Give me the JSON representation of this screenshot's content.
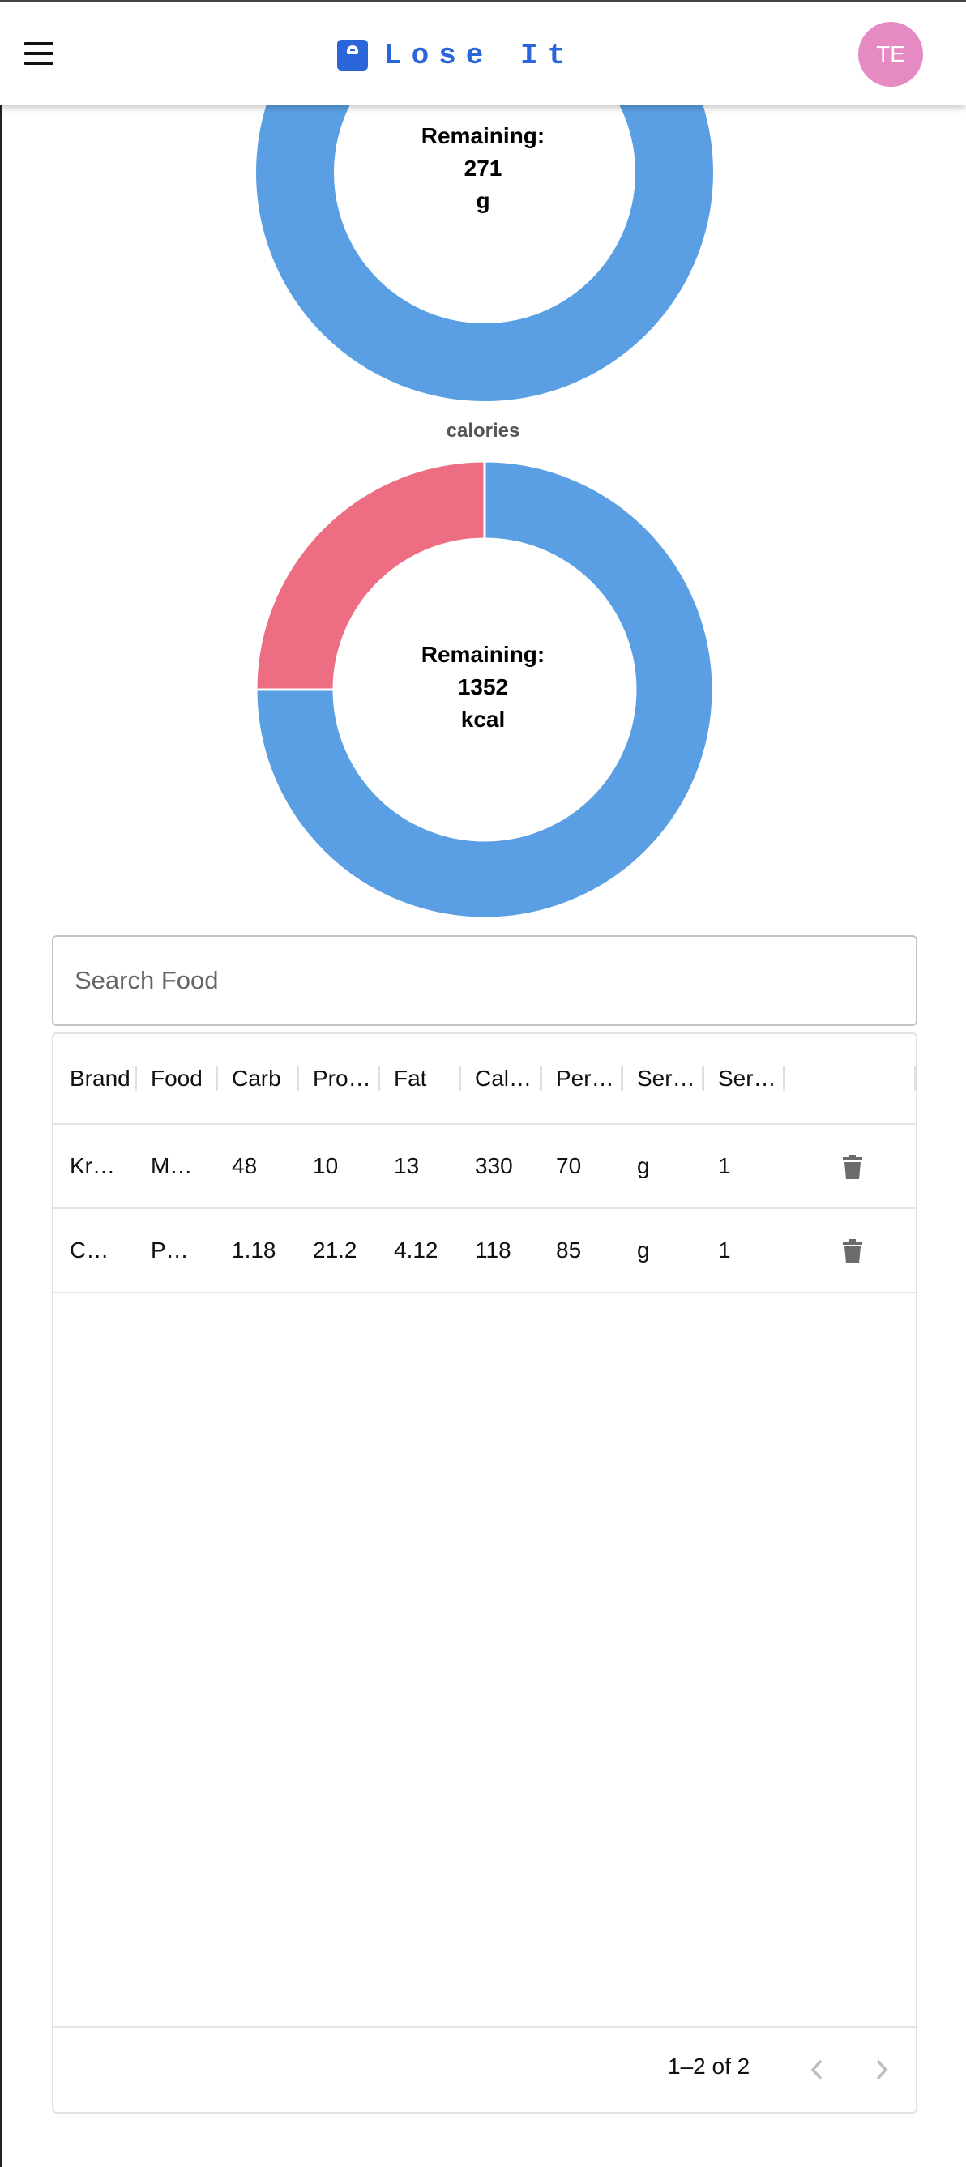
{
  "appbar": {
    "title": "Lose It",
    "avatar_initials": "TE",
    "brand_color": "#2a66d9",
    "avatar_color": "#e58ac3"
  },
  "charts": {
    "macro": {
      "remaining_label": "Remaining:",
      "remaining_value": "271",
      "remaining_unit": "g",
      "consumed_fraction": 0,
      "consumed_color": "#ed6e83",
      "remaining_color": "#5a9fe3"
    },
    "calories": {
      "title": "calories",
      "remaining_label": "Remaining:",
      "remaining_value": "1352",
      "remaining_unit": "kcal",
      "consumed_fraction": 0.25,
      "consumed_color": "#ed6e83",
      "remaining_color": "#5a9fe3"
    }
  },
  "search": {
    "placeholder": "Search Food",
    "value": ""
  },
  "table": {
    "columns": [
      "Brand",
      "Food",
      "Carb",
      "Pro…",
      "Fat",
      "Cal…",
      "Per…",
      "Ser…",
      "Ser…"
    ],
    "rows": [
      [
        "Kr…",
        "M…",
        "48",
        "10",
        "13",
        "330",
        "70",
        "g",
        "1"
      ],
      [
        "C…",
        "P…",
        "1.18",
        "21.2",
        "4.12",
        "118",
        "85",
        "g",
        "1"
      ]
    ],
    "delete_icon": "trash-icon"
  },
  "pagination": {
    "label": "1–2 of 2",
    "prev_icon": "chevron-left-icon",
    "next_icon": "chevron-right-icon"
  }
}
